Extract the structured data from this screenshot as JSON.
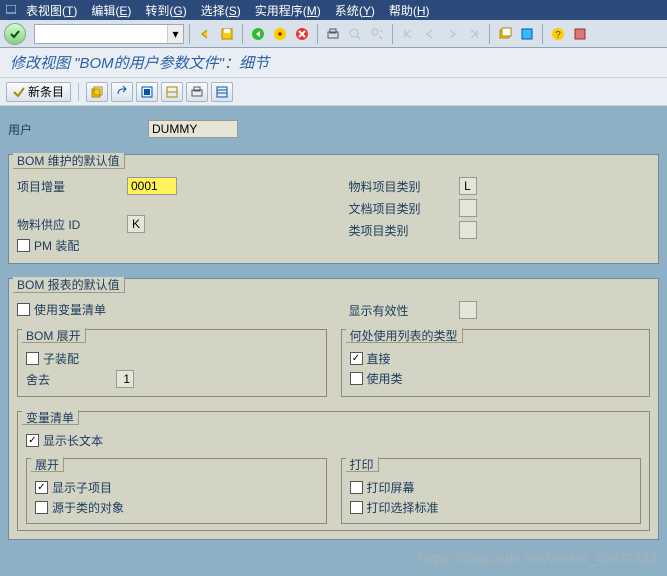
{
  "menu": {
    "items": [
      {
        "label": "表视图",
        "key": "T"
      },
      {
        "label": "编辑",
        "key": "E"
      },
      {
        "label": "转到",
        "key": "G"
      },
      {
        "label": "选择",
        "key": "S"
      },
      {
        "label": "实用程序",
        "key": "M"
      },
      {
        "label": "系统",
        "key": "Y"
      },
      {
        "label": "帮助",
        "key": "H"
      }
    ]
  },
  "title": "修改视图 \"BOM的用户参数文件\"：细节",
  "toolbar_newentry": "新条目",
  "user_label": "用户",
  "user_value": "DUMMY",
  "group1": {
    "legend": "BOM 维护的默认值",
    "item_increment_label": "项目增量",
    "item_increment_value": "0001",
    "material_supply_label": "物料供应 ID",
    "material_supply_value": "K",
    "material_item_cat_label": "物料项目类别",
    "material_item_cat_value": "L",
    "doc_item_cat_label": "文档项目类别",
    "doc_item_cat_value": "",
    "class_item_cat_label": "类项目类别",
    "class_item_cat_value": "",
    "pm_assembly_label": "PM 装配"
  },
  "group2": {
    "legend": "BOM 报表的默认值",
    "var_list_label": "使用变量清单",
    "show_validity_label": "显示有效性",
    "show_validity_value": "",
    "bom_expand_legend": "BOM 展开",
    "subassembly_label": "子装配",
    "discard_label": "舍去",
    "discard_value": "1",
    "where_used_legend": "何处使用列表的类型",
    "direct_label": "直接",
    "by_class_label": "使用类",
    "variant_list_legend": "变量清单",
    "show_longtext_label": "显示长文本",
    "expand_legend": "展开",
    "show_subitems_label": "显示子项目",
    "class_origin_objs_label": "源于类的对象",
    "print_legend": "打印",
    "print_screen_label": "打印屏幕",
    "print_sel_criteria_label": "打印选择标准"
  },
  "watermark": "https://blog.csdn.net/weixin_40672823"
}
